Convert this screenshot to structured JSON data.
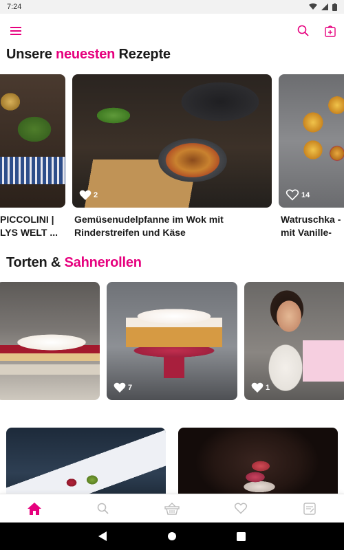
{
  "status": {
    "time": "7:24"
  },
  "colors": {
    "accent": "#e6007e",
    "icon_grey": "#bdbdbd"
  },
  "sections": [
    {
      "title_plain": "Unsere ",
      "title_accent": "neuesten",
      "title_rest": " Rezepte",
      "cards": [
        {
          "title": "PICCOLINI |\nLYS WELT ...",
          "likes": ""
        },
        {
          "title": "Gemüsenudelpfanne im Wok mit\nRinderstreifen und Käse",
          "likes": "2"
        },
        {
          "title": "Watruschka -\nmit Vanille-Qu",
          "likes": "14"
        }
      ]
    },
    {
      "title_plain": "Torten & ",
      "title_accent": "Sahnerollen",
      "title_rest": "",
      "cards": [
        {
          "likes": ""
        },
        {
          "likes": "7"
        },
        {
          "likes": "1"
        }
      ]
    }
  ],
  "icons": {
    "menu": "hamburger-icon",
    "search": "search-icon",
    "shopping_list": "shopping-list-icon",
    "nav_home": "home-icon",
    "nav_search": "search-icon",
    "nav_basket": "basket-icon",
    "nav_favorites": "heart-icon",
    "nav_notes": "notes-icon"
  }
}
